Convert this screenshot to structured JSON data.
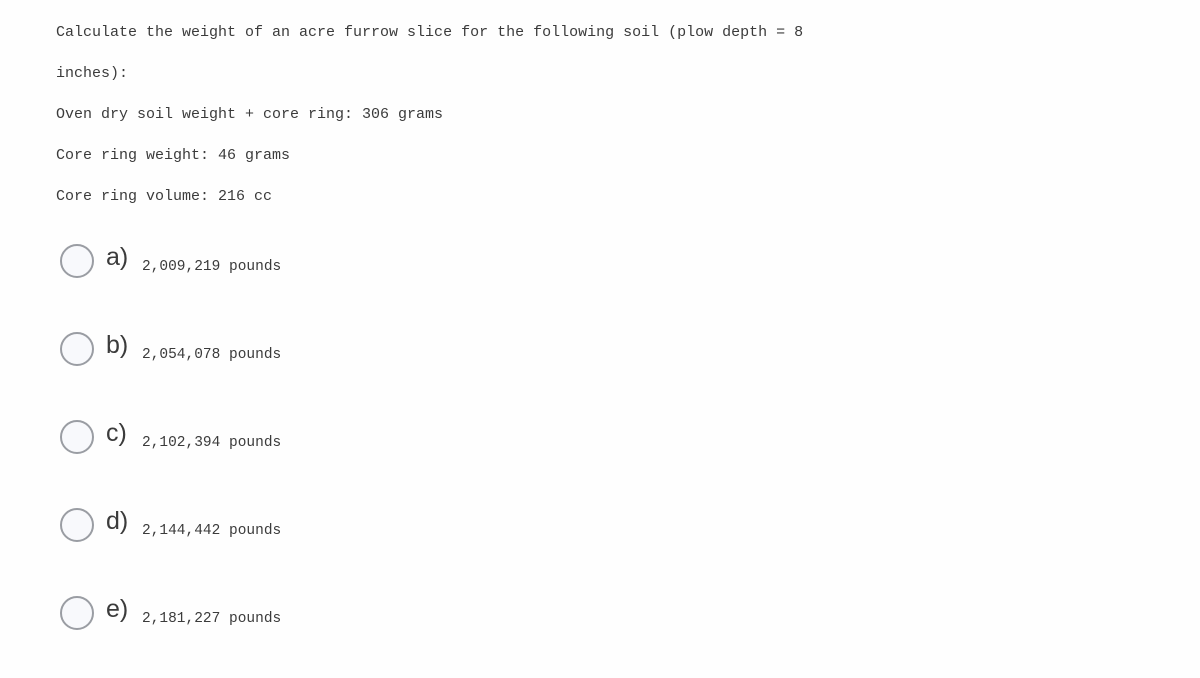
{
  "question": {
    "prompt_lines": [
      "Calculate the weight of an acre furrow slice for the following soil (plow depth = 8",
      "inches):"
    ],
    "givens": [
      "Oven dry soil weight + core ring: 306 grams",
      "Core ring weight: 46 grams",
      "Core ring volume: 216 cc"
    ]
  },
  "options": [
    {
      "letter": "a)",
      "value": "2,009,219 pounds",
      "radio_icon": "radio-unchecked-icon"
    },
    {
      "letter": "b)",
      "value": "2,054,078 pounds",
      "radio_icon": "radio-unchecked-icon"
    },
    {
      "letter": "c)",
      "value": "2,102,394 pounds",
      "radio_icon": "radio-unchecked-icon"
    },
    {
      "letter": "d)",
      "value": "2,144,442 pounds",
      "radio_icon": "radio-unchecked-icon"
    },
    {
      "letter": "e)",
      "value": "2,181,227 pounds",
      "radio_icon": "radio-unchecked-icon"
    }
  ],
  "colors": {
    "background": "#fefefe",
    "text": "#3b3b3b",
    "radio_border": "#9a9da3",
    "radio_fill": "#f8f9fc"
  }
}
